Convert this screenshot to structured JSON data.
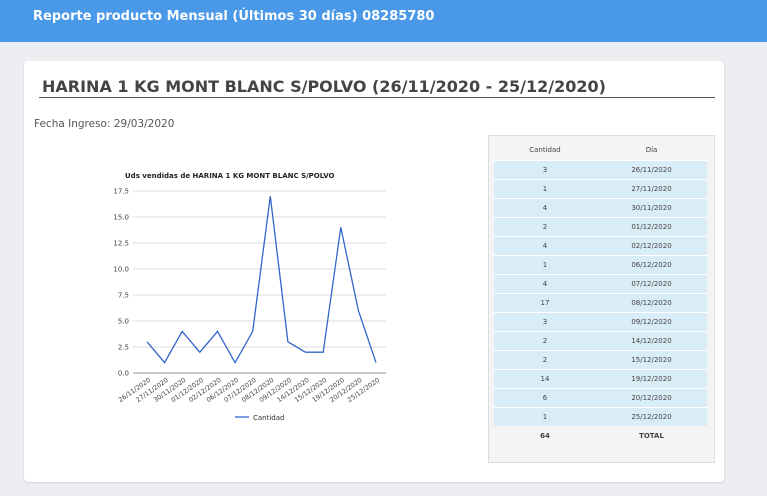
{
  "header": {
    "title": "Reporte producto Mensual (Últimos 30 días) 08285780"
  },
  "report": {
    "product_title": "HARINA 1 KG MONT BLANC S/POLVO (26/11/2020 - 25/12/2020)",
    "fecha_ingreso": "Fecha Ingreso: 29/03/2020"
  },
  "table": {
    "headers": [
      "Cantidad",
      "Día"
    ],
    "rows": [
      {
        "cantidad": "3",
        "dia": "26/11/2020"
      },
      {
        "cantidad": "1",
        "dia": "27/11/2020"
      },
      {
        "cantidad": "4",
        "dia": "30/11/2020"
      },
      {
        "cantidad": "2",
        "dia": "01/12/2020"
      },
      {
        "cantidad": "4",
        "dia": "02/12/2020"
      },
      {
        "cantidad": "1",
        "dia": "06/12/2020"
      },
      {
        "cantidad": "4",
        "dia": "07/12/2020"
      },
      {
        "cantidad": "17",
        "dia": "08/12/2020"
      },
      {
        "cantidad": "3",
        "dia": "09/12/2020"
      },
      {
        "cantidad": "2",
        "dia": "14/12/2020"
      },
      {
        "cantidad": "2",
        "dia": "15/12/2020"
      },
      {
        "cantidad": "14",
        "dia": "19/12/2020"
      },
      {
        "cantidad": "6",
        "dia": "20/12/2020"
      },
      {
        "cantidad": "1",
        "dia": "25/12/2020"
      }
    ],
    "total_cantidad": "64",
    "total_label": "TOTAL"
  },
  "colors": {
    "header_bg": "#4a98e8",
    "line": "#3366cc",
    "table_row": "#d9edf7"
  },
  "chart_data": {
    "type": "line",
    "title": "Uds vendidas de HARINA 1 KG MONT BLANC S/POLVO",
    "categories": [
      "26/11/2020",
      "27/11/2020",
      "30/11/2020",
      "01/12/2020",
      "02/12/2020",
      "06/12/2020",
      "07/12/2020",
      "08/12/2020",
      "09/12/2020",
      "14/12/2020",
      "15/12/2020",
      "19/12/2020",
      "20/12/2020",
      "25/12/2020"
    ],
    "series": [
      {
        "name": "Cantidad",
        "values": [
          3,
          1,
          4,
          2,
          4,
          1,
          4,
          17,
          3,
          2,
          2,
          14,
          6,
          1
        ]
      }
    ],
    "yticks": [
      "0.0",
      "2.5",
      "5.0",
      "7.5",
      "10.0",
      "12.5",
      "15.0",
      "17.5"
    ],
    "ylim": [
      0,
      17.5
    ],
    "grid": true,
    "legend": "bottom"
  }
}
